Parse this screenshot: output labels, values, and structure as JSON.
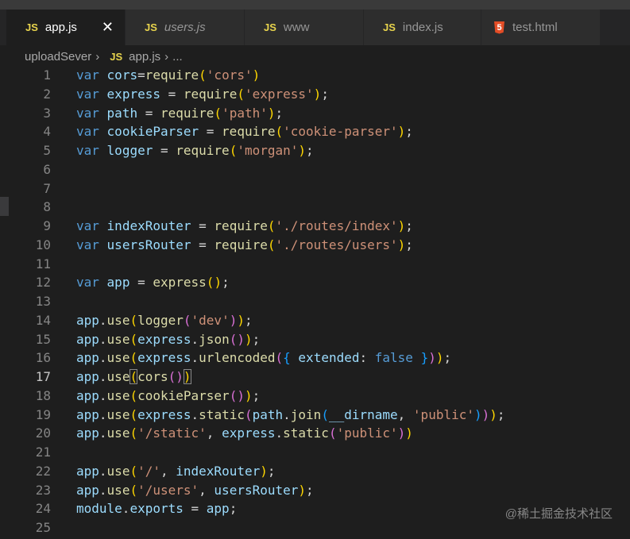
{
  "tabs": [
    {
      "label": "app.js",
      "icon": "js-icon",
      "active": true
    },
    {
      "label": "users.js",
      "icon": "js-icon",
      "italic": true
    },
    {
      "label": "www",
      "icon": "js-icon"
    },
    {
      "label": "index.js",
      "icon": "js-icon"
    },
    {
      "label": "test.html",
      "icon": "html5-icon"
    }
  ],
  "icons": {
    "js": "JS",
    "html5": "5",
    "close": "✕"
  },
  "breadcrumb": {
    "folder": "uploadSever",
    "sep": "›",
    "file": "app.js",
    "more": "..."
  },
  "current_line": 17,
  "lines": [
    [
      [
        "var",
        "k"
      ],
      [
        " ",
        "p"
      ],
      [
        "cors",
        "v"
      ],
      [
        "=",
        "p"
      ],
      [
        "require",
        "f"
      ],
      [
        "(",
        "b1"
      ],
      [
        "'cors'",
        "s"
      ],
      [
        ")",
        "b1"
      ]
    ],
    [
      [
        "var",
        "k"
      ],
      [
        " ",
        "p"
      ],
      [
        "express",
        "v"
      ],
      [
        " = ",
        "p"
      ],
      [
        "require",
        "f"
      ],
      [
        "(",
        "b1"
      ],
      [
        "'express'",
        "s"
      ],
      [
        ")",
        "b1"
      ],
      [
        ";",
        "p"
      ]
    ],
    [
      [
        "var",
        "k"
      ],
      [
        " ",
        "p"
      ],
      [
        "path",
        "v"
      ],
      [
        " = ",
        "p"
      ],
      [
        "require",
        "f"
      ],
      [
        "(",
        "b1"
      ],
      [
        "'path'",
        "s"
      ],
      [
        ")",
        "b1"
      ],
      [
        ";",
        "p"
      ]
    ],
    [
      [
        "var",
        "k"
      ],
      [
        " ",
        "p"
      ],
      [
        "cookieParser",
        "v"
      ],
      [
        " = ",
        "p"
      ],
      [
        "require",
        "f"
      ],
      [
        "(",
        "b1"
      ],
      [
        "'cookie-parser'",
        "s"
      ],
      [
        ")",
        "b1"
      ],
      [
        ";",
        "p"
      ]
    ],
    [
      [
        "var",
        "k"
      ],
      [
        " ",
        "p"
      ],
      [
        "logger",
        "v"
      ],
      [
        " = ",
        "p"
      ],
      [
        "require",
        "f"
      ],
      [
        "(",
        "b1"
      ],
      [
        "'morgan'",
        "s"
      ],
      [
        ")",
        "b1"
      ],
      [
        ";",
        "p"
      ]
    ],
    [],
    [],
    [],
    [
      [
        "var",
        "k"
      ],
      [
        " ",
        "p"
      ],
      [
        "indexRouter",
        "v"
      ],
      [
        " = ",
        "p"
      ],
      [
        "require",
        "f"
      ],
      [
        "(",
        "b1"
      ],
      [
        "'./routes/index'",
        "s"
      ],
      [
        ")",
        "b1"
      ],
      [
        ";",
        "p"
      ]
    ],
    [
      [
        "var",
        "k"
      ],
      [
        " ",
        "p"
      ],
      [
        "usersRouter",
        "v"
      ],
      [
        " = ",
        "p"
      ],
      [
        "require",
        "f"
      ],
      [
        "(",
        "b1"
      ],
      [
        "'./routes/users'",
        "s"
      ],
      [
        ")",
        "b1"
      ],
      [
        ";",
        "p"
      ]
    ],
    [],
    [
      [
        "var",
        "k"
      ],
      [
        " ",
        "p"
      ],
      [
        "app",
        "v"
      ],
      [
        " = ",
        "p"
      ],
      [
        "express",
        "f"
      ],
      [
        "(",
        "b1"
      ],
      [
        ")",
        "b1"
      ],
      [
        ";",
        "p"
      ]
    ],
    [],
    [
      [
        "app",
        "v"
      ],
      [
        ".",
        "p"
      ],
      [
        "use",
        "f"
      ],
      [
        "(",
        "b1"
      ],
      [
        "logger",
        "f"
      ],
      [
        "(",
        "b2"
      ],
      [
        "'dev'",
        "s"
      ],
      [
        ")",
        "b2"
      ],
      [
        ")",
        "b1"
      ],
      [
        ";",
        "p"
      ]
    ],
    [
      [
        "app",
        "v"
      ],
      [
        ".",
        "p"
      ],
      [
        "use",
        "f"
      ],
      [
        "(",
        "b1"
      ],
      [
        "express",
        "v"
      ],
      [
        ".",
        "p"
      ],
      [
        "json",
        "f"
      ],
      [
        "(",
        "b2"
      ],
      [
        ")",
        "b2"
      ],
      [
        ")",
        "b1"
      ],
      [
        ";",
        "p"
      ]
    ],
    [
      [
        "app",
        "v"
      ],
      [
        ".",
        "p"
      ],
      [
        "use",
        "f"
      ],
      [
        "(",
        "b1"
      ],
      [
        "express",
        "v"
      ],
      [
        ".",
        "p"
      ],
      [
        "urlencoded",
        "f"
      ],
      [
        "(",
        "b2"
      ],
      [
        "{",
        "b3"
      ],
      [
        " ",
        "p"
      ],
      [
        "extended",
        "v"
      ],
      [
        ": ",
        "p"
      ],
      [
        "false",
        "c"
      ],
      [
        " ",
        "p"
      ],
      [
        "}",
        "b3"
      ],
      [
        ")",
        "b2"
      ],
      [
        ")",
        "b1"
      ],
      [
        ";",
        "p"
      ]
    ],
    [
      [
        "app",
        "v"
      ],
      [
        ".",
        "p"
      ],
      [
        "use",
        "f"
      ],
      [
        "(",
        "b1 m"
      ],
      [
        "cors",
        "f"
      ],
      [
        "(",
        "b2"
      ],
      [
        ")",
        "b2"
      ],
      [
        ")",
        "b1 m"
      ]
    ],
    [
      [
        "app",
        "v"
      ],
      [
        ".",
        "p"
      ],
      [
        "use",
        "f"
      ],
      [
        "(",
        "b1"
      ],
      [
        "cookieParser",
        "f"
      ],
      [
        "(",
        "b2"
      ],
      [
        ")",
        "b2"
      ],
      [
        ")",
        "b1"
      ],
      [
        ";",
        "p"
      ]
    ],
    [
      [
        "app",
        "v"
      ],
      [
        ".",
        "p"
      ],
      [
        "use",
        "f"
      ],
      [
        "(",
        "b1"
      ],
      [
        "express",
        "v"
      ],
      [
        ".",
        "p"
      ],
      [
        "static",
        "f"
      ],
      [
        "(",
        "b2"
      ],
      [
        "path",
        "v"
      ],
      [
        ".",
        "p"
      ],
      [
        "join",
        "f"
      ],
      [
        "(",
        "b3"
      ],
      [
        "__dirname",
        "v"
      ],
      [
        ", ",
        "p"
      ],
      [
        "'public'",
        "s"
      ],
      [
        ")",
        "b3"
      ],
      [
        ")",
        "b2"
      ],
      [
        ")",
        "b1"
      ],
      [
        ";",
        "p"
      ]
    ],
    [
      [
        "app",
        "v"
      ],
      [
        ".",
        "p"
      ],
      [
        "use",
        "f"
      ],
      [
        "(",
        "b1"
      ],
      [
        "'/static'",
        "s"
      ],
      [
        ", ",
        "p"
      ],
      [
        "express",
        "v"
      ],
      [
        ".",
        "p"
      ],
      [
        "static",
        "f"
      ],
      [
        "(",
        "b2"
      ],
      [
        "'public'",
        "s"
      ],
      [
        ")",
        "b2"
      ],
      [
        ")",
        "b1"
      ]
    ],
    [],
    [
      [
        "app",
        "v"
      ],
      [
        ".",
        "p"
      ],
      [
        "use",
        "f"
      ],
      [
        "(",
        "b1"
      ],
      [
        "'/'",
        "s"
      ],
      [
        ", ",
        "p"
      ],
      [
        "indexRouter",
        "v"
      ],
      [
        ")",
        "b1"
      ],
      [
        ";",
        "p"
      ]
    ],
    [
      [
        "app",
        "v"
      ],
      [
        ".",
        "p"
      ],
      [
        "use",
        "f"
      ],
      [
        "(",
        "b1"
      ],
      [
        "'/users'",
        "s"
      ],
      [
        ", ",
        "p"
      ],
      [
        "usersRouter",
        "v"
      ],
      [
        ")",
        "b1"
      ],
      [
        ";",
        "p"
      ]
    ],
    [
      [
        "module",
        "v"
      ],
      [
        ".",
        "p"
      ],
      [
        "exports",
        "v"
      ],
      [
        " = ",
        "p"
      ],
      [
        "app",
        "v"
      ],
      [
        ";",
        "p"
      ]
    ],
    []
  ],
  "watermark": "@稀土掘金技术社区"
}
